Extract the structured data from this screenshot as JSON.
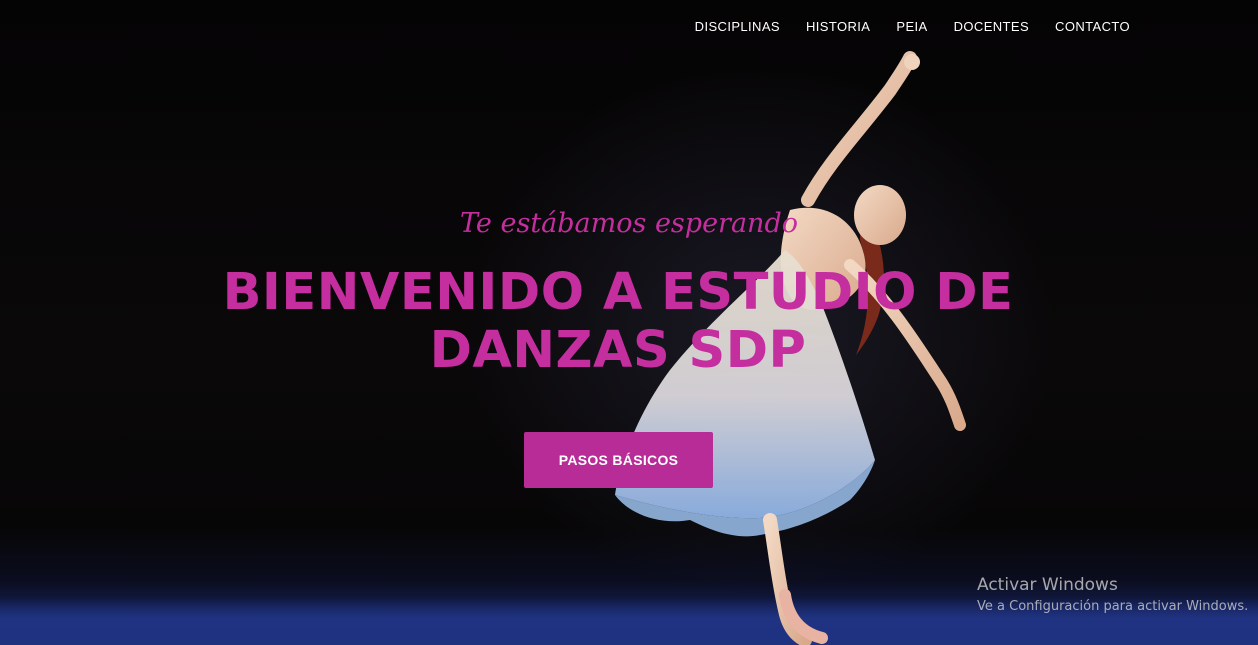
{
  "nav": {
    "items": [
      {
        "label": "DISCIPLINAS"
      },
      {
        "label": "HISTORIA"
      },
      {
        "label": "PEIA"
      },
      {
        "label": "DOCENTES"
      },
      {
        "label": "CONTACTO"
      }
    ]
  },
  "hero": {
    "subtitle": "Te estábamos esperando",
    "headline_line1": "BIENVENIDO A ESTUDIO DE",
    "headline_line2": "DANZAS SDP",
    "cta_label": "PASOS BÁSICOS",
    "background_image": "ballerina-leaping-on-stage"
  },
  "watermark": {
    "title": "Activar Windows",
    "subtitle": "Ve a Configuración para activar Windows."
  },
  "colors": {
    "accent": "#c52e9f",
    "button": "#b82c98",
    "nav_text": "#ffffff",
    "background": "#000000"
  }
}
